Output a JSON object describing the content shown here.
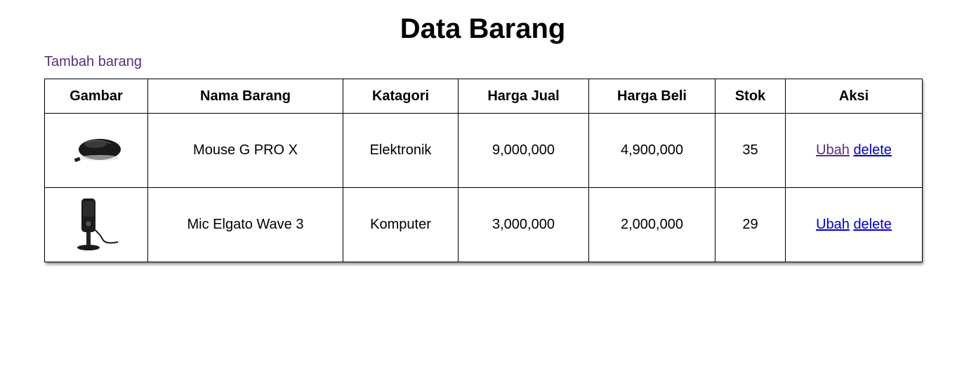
{
  "page": {
    "title": "Data Barang",
    "add_link": "Tambah barang"
  },
  "table": {
    "headers": [
      "Gambar",
      "Nama Barang",
      "Katagori",
      "Harga Jual",
      "Harga Beli",
      "Stok",
      "Aksi"
    ],
    "rows": [
      {
        "image_icon": "mouse-image",
        "name": "Mouse G PRO X",
        "category": "Elektronik",
        "sell_price": "9,000,000",
        "buy_price": "4,900,000",
        "stock": "35",
        "edit_label": "Ubah",
        "delete_label": "delete"
      },
      {
        "image_icon": "microphone-image",
        "name": "Mic Elgato Wave 3",
        "category": "Komputer",
        "sell_price": "3,000,000",
        "buy_price": "2,000,000",
        "stock": "29",
        "edit_label": "Ubah",
        "delete_label": "delete"
      }
    ]
  },
  "colors": {
    "visited_link": "#5a2d82",
    "link": "#0000cc"
  }
}
